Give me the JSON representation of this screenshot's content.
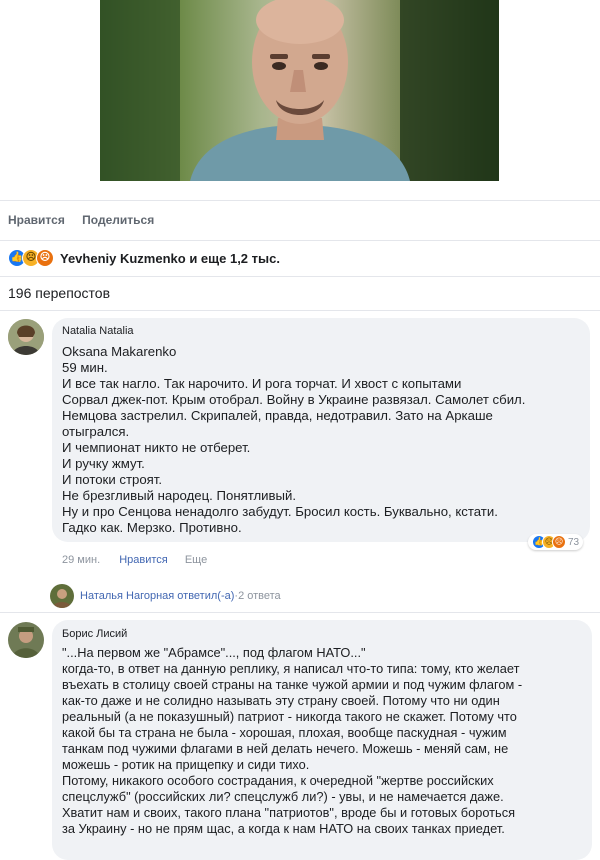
{
  "post": {
    "actions": {
      "like_label": "Нравится",
      "share_label": "Поделиться"
    },
    "reactions": {
      "icons": [
        "like-icon",
        "sad-icon",
        "angry-icon"
      ],
      "summary": "Yevheniy Kuzmenko и еще 1,2 тыс."
    },
    "shares": "196 перепостов"
  },
  "comments": [
    {
      "author": "Natalia Natalia",
      "text": "Oksana Makarenko\n59 мин.\nИ все так нагло. Так нарочито. И рога торчат. И хвост с копытами\nСорвал джек-пот. Крым отобрал. Войну в Украине развязал. Самолет сбил.\nНемцова застрелил. Скрипалей, правда, недотравил. Зато на Аркаше\nотыгрался.\nИ чемпионат никто не отберет.\nИ ручку жмут.\nИ потоки строят.\nНе брезгливый народец. Понятливый.\nНу и про Сенцова ненадолго забудут. Бросил кость. Буквально, кстати.\nГадко как. Мерзко. Противно.",
      "time": "29 мин.",
      "like_label": "Нравится",
      "more_label": "Еще",
      "reaction_count": "73"
    },
    {
      "author": "Борис Лисий",
      "text": "\"...На первом же \"Абрамсе\"..., под флагом НАТО...\"\nкогда-то, в ответ на данную реплику, я написал что-то типа: тому, кто желает\nвъехать в столицу своей страны на танке чужой армии и под чужим флагом -\nкак-то даже и не солидно называть эту страну своей. Потому что ни один\nреальный (а не показушный) патриот - никогда такого не скажет. Потому что\nкакой бы та страна не была - хорошая, плохая, вообще паскудная - чужим\nтанкам под чужими флагами в ней делать нечего. Можешь - меняй сам, не\nможешь - ротик на прищепку и сиди тихо.\nПотому, никакого особого сострадания, к очередной \"жертве российских\nспецслужб\" (российских ли? спецслужб ли?) - увы, и не намечается даже.\nХватит нам и своих, такого плана \"патриотов\", вроде бы и готовых бороться\nза Украину - но не прям щас, а когда к нам НАТО на своих танках приедет."
    }
  ],
  "reply_row": {
    "author_text": "Наталья Нагорная ответил(-а)",
    "separator": " · ",
    "count": "2 ответа"
  }
}
